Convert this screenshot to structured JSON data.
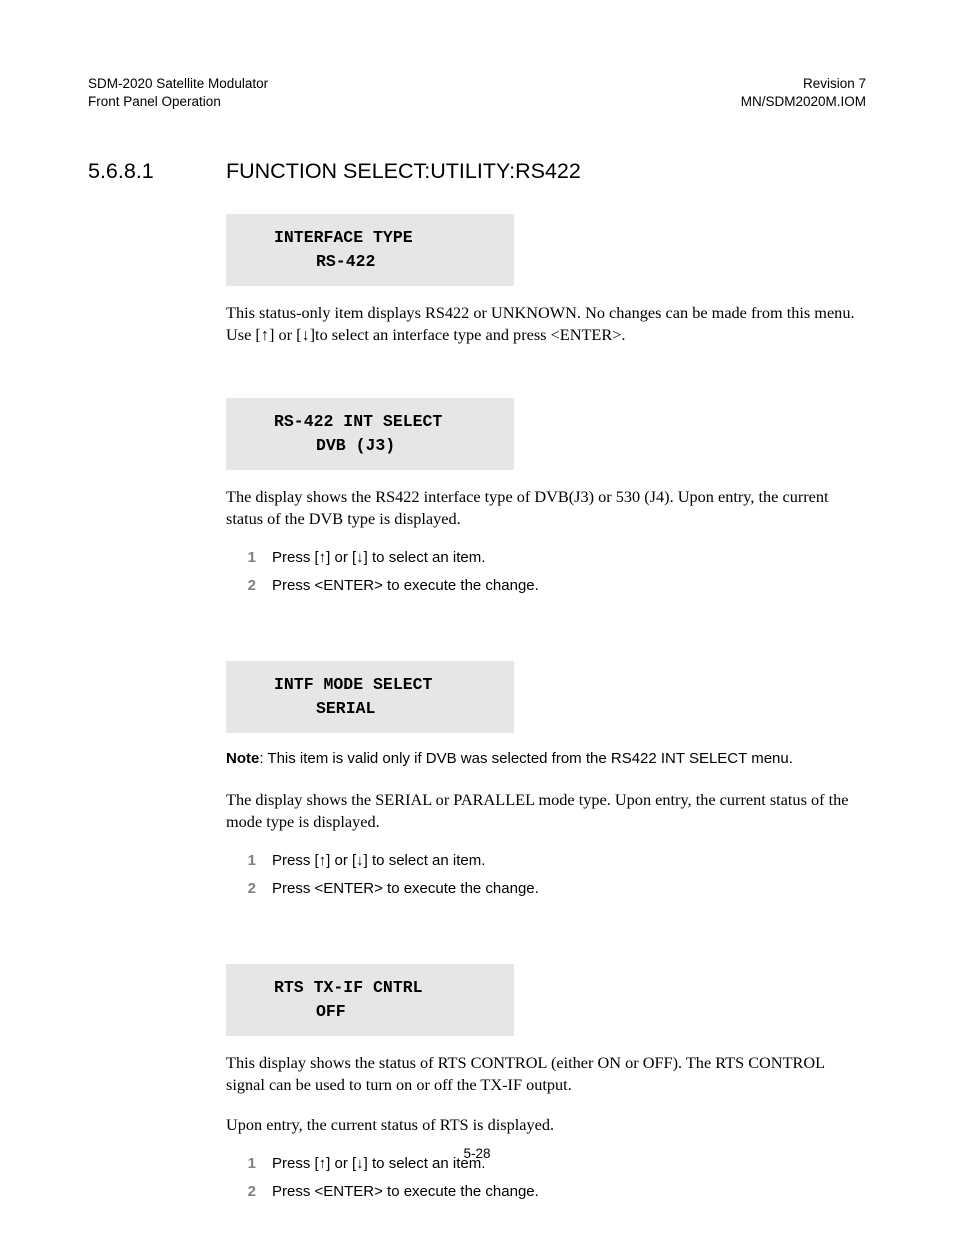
{
  "header": {
    "left_line1": "SDM-2020 Satellite Modulator",
    "left_line2": "Front Panel Operation",
    "right_line1": "Revision 7",
    "right_line2": "MN/SDM2020M.IOM"
  },
  "section": {
    "number": "5.6.8.1",
    "title": "FUNCTION SELECT:UTILITY:RS422"
  },
  "blocks": {
    "box1_line1": "INTERFACE TYPE",
    "box1_line2": "RS-422",
    "para1": "This status-only item displays RS422 or UNKNOWN. No changes can be made from this menu. Use [↑] or [↓]to select an interface type and press <ENTER>.",
    "box2_line1": "RS-422 INT SELECT",
    "box2_line2": "DVB (J3)",
    "para2": "The display shows the RS422 interface type of DVB(J3) or 530 (J4). Upon entry, the current status of the DVB type is displayed.",
    "box3_line1": "INTF MODE SELECT",
    "box3_line2": "SERIAL",
    "note_label": "Note",
    "note_text": ": This item is valid only if DVB was selected from the RS422 INT SELECT menu.",
    "para3": "The display shows the SERIAL or PARALLEL mode type. Upon entry, the current status of the mode type is displayed.",
    "box4_line1": "RTS TX-IF CNTRL",
    "box4_line2": "OFF",
    "para4": "This display shows the status of RTS CONTROL (either ON or OFF). The RTS CONTROL signal can be used to turn on or off the TX-IF output.",
    "para5": "Upon entry, the current status of RTS is displayed."
  },
  "steps": {
    "n1": "1",
    "n2": "2",
    "s1": "Press [↑] or [↓] to select an item.",
    "s2": "Press <ENTER> to execute the change."
  },
  "footer": "5-28"
}
